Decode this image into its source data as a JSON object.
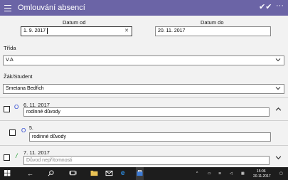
{
  "app": {
    "title": "Omlouvání absencí",
    "check_glyph": "✔✔",
    "more_glyph": "···"
  },
  "dates": {
    "from_label": "Datum od",
    "from_value": "1. 9. 2017",
    "to_label": "Datum do",
    "to_value": "20. 11. 2017"
  },
  "trida": {
    "label": "Třída",
    "value": "V.A"
  },
  "student": {
    "label": "Žák/Student",
    "value": "Smetana Bedřich"
  },
  "rows": [
    {
      "date": "6. 11. 2017",
      "status": "O",
      "reason": "rodinné důvody"
    },
    {
      "date": "5.",
      "status": "O",
      "reason": "rodinné důvody"
    },
    {
      "date": "7. 11. 2017",
      "status": "/",
      "reason_placeholder": "Důvod nepřítomnosti"
    }
  ],
  "colors": {
    "accent": "#6b64a6",
    "status_o": "#1f3bd1",
    "status_slash": "#1a9c2b"
  },
  "taskbar": {
    "time": "15:06",
    "date": "20.11.2017",
    "icons": [
      "windows-icon",
      "back-icon",
      "search-icon",
      "task-view-icon",
      "file-explorer-icon",
      "mail-icon",
      "edge-icon",
      "store-icon",
      "app-icon"
    ]
  }
}
